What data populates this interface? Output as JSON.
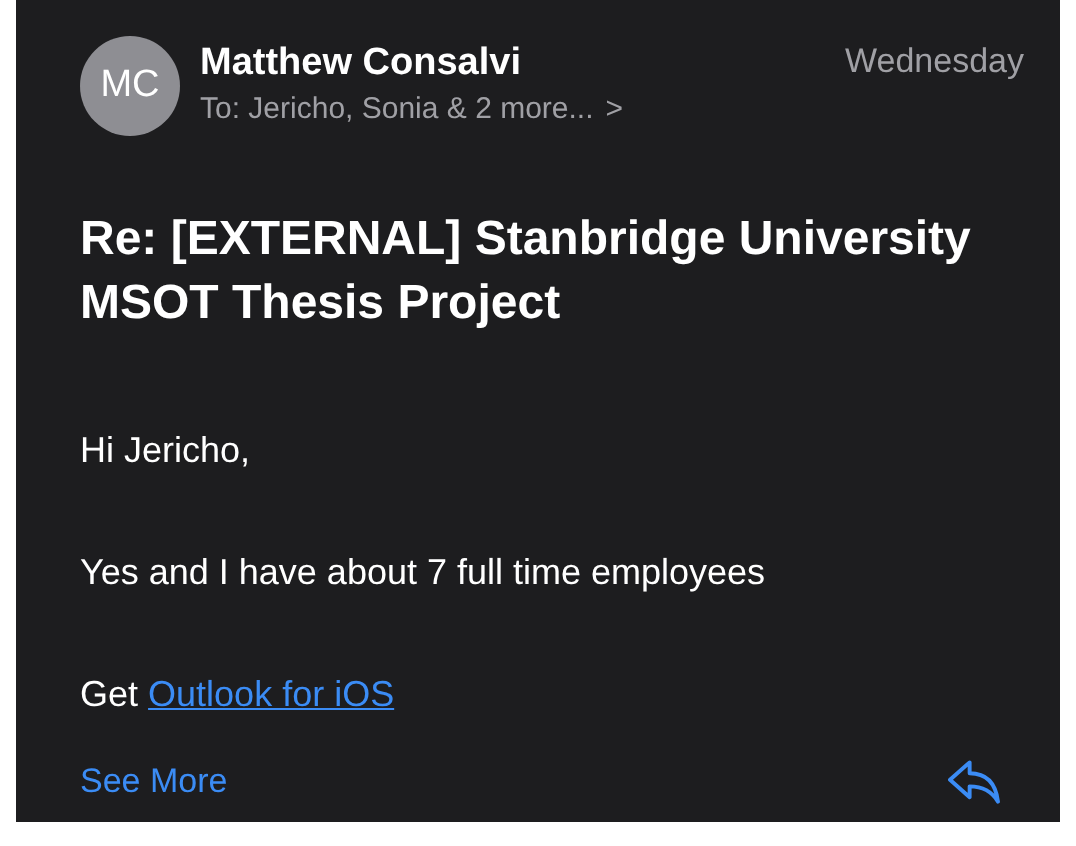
{
  "message": {
    "avatar_initials": "MC",
    "sender": "Matthew Consalvi",
    "recipients": "To: Jericho, Sonia & 2 more...",
    "recipients_chevron": ">",
    "date": "Wednesday",
    "subject": "Re: [EXTERNAL] Stanbridge University MSOT Thesis Project",
    "body": [
      {
        "kind": "text",
        "text": "Hi Jericho,"
      },
      {
        "kind": "text",
        "text": "Yes and I have about 7 full time employees"
      },
      {
        "kind": "link_line",
        "text": "Get",
        "link": "Outlook for iOS"
      }
    ],
    "see_more": "See More"
  }
}
